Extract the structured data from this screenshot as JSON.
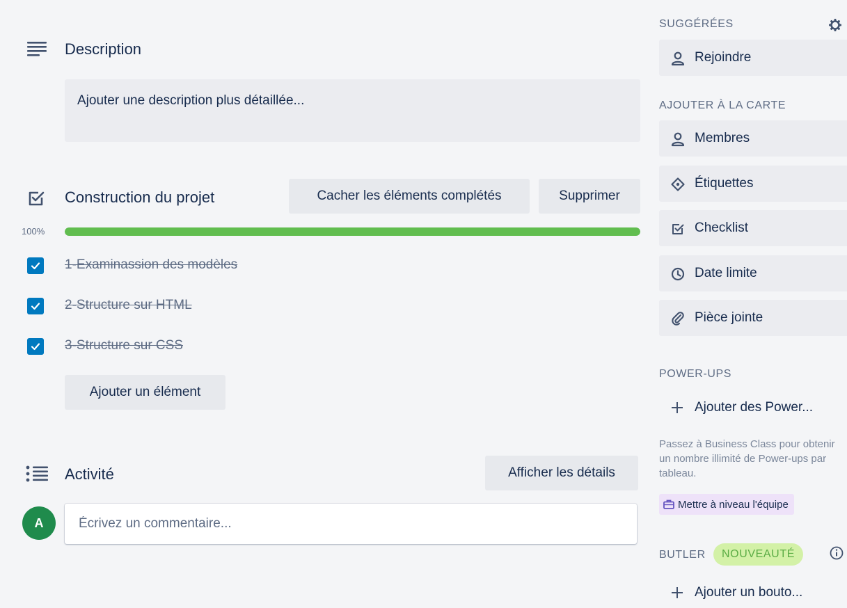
{
  "description": {
    "title": "Description",
    "placeholder": "Ajouter une description plus détaillée..."
  },
  "checklist": {
    "title": "Construction du projet",
    "hide_completed_label": "Cacher les éléments complétés",
    "delete_label": "Supprimer",
    "progress_label": "100%",
    "progress_value": 100,
    "items": [
      {
        "label": "1-Examinassion des modèles",
        "checked": true
      },
      {
        "label": "2-Structure sur HTML",
        "checked": true
      },
      {
        "label": "3-Structure sur CSS",
        "checked": true
      }
    ],
    "add_item_label": "Ajouter un élément"
  },
  "activity": {
    "title": "Activité",
    "show_details_label": "Afficher les détails",
    "avatar_initial": "A",
    "comment_placeholder": "Écrivez un commentaire..."
  },
  "sidebar": {
    "suggested_heading": "SUGGÉRÉES",
    "join_label": "Rejoindre",
    "add_to_card_heading": "AJOUTER À LA CARTE",
    "add_to_card": [
      {
        "label": "Membres",
        "icon": "person-icon"
      },
      {
        "label": "Étiquettes",
        "icon": "tag-icon"
      },
      {
        "label": "Checklist",
        "icon": "checklist-icon"
      },
      {
        "label": "Date limite",
        "icon": "clock-icon"
      },
      {
        "label": "Pièce jointe",
        "icon": "paperclip-icon"
      }
    ],
    "powerups_heading": "POWER-UPS",
    "add_powerups_label": "Ajouter des Power...",
    "upsell_text": "Passez à Business Class pour obtenir un nombre illimité de Power-ups par tableau.",
    "upgrade_label": "Mettre à niveau l'équipe",
    "butler_heading": "BUTLER",
    "butler_badge": "NOUVEAUTÉ",
    "add_button_label": "Ajouter un bouto..."
  },
  "colors": {
    "checkbox": "#0079bf",
    "progress": "#61bd4f",
    "avatar": "#1f8b4c",
    "badge_bg": "#d3f1a7",
    "upgrade_bg": "#eee2f9"
  }
}
